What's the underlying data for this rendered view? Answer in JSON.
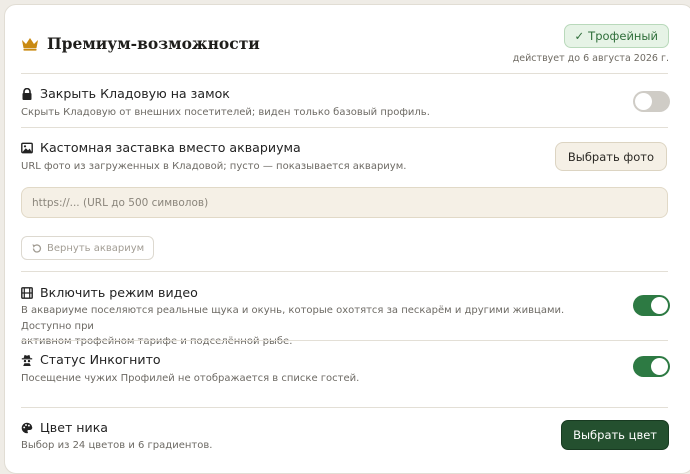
{
  "header": {
    "title": "Премиум-возможности",
    "badge_check": "✓",
    "badge": "Трофейный",
    "valid_until": "действует до 6 августа 2026 г."
  },
  "lock_section": {
    "title": "Закрыть Кладовую на замок",
    "description": "Скрыть Кладовую от внешних посетителей; виден только базовый профиль.",
    "toggle_on": false
  },
  "splash_section": {
    "title": "Кастомная заставка вместо аквариума",
    "description": "URL фото из загруженных в Кладовой; пусто — показывается аквариум.",
    "choose_photo_label": "Выбрать фото",
    "url_value": "",
    "url_placeholder": "https://... (URL до 500 символов)",
    "restore_label": "Вернуть аквариум"
  },
  "video_section": {
    "title": "Включить режим видео",
    "description_line1": "В аквариуме поселяются реальные щука и окунь, которые охотятся за пескарём и другими живцами. Доступно при",
    "description_line2": "активном трофейном тарифе и подселённой рыбе.",
    "toggle_on": true
  },
  "incognito_section": {
    "title": "Статус Инкогнито",
    "description": "Посещение чужих Профилей не отображается в списке гостей.",
    "toggle_on": true
  },
  "nick_color_section": {
    "title": "Цвет ника",
    "description": "Выбор из 24 цветов и 6 градиентов.",
    "choose_color_label": "Выбрать цвет"
  },
  "colors": {
    "accent_green": "#2d7a43",
    "dark_green_button": "#24502f",
    "badge_bg": "#e6f3e6",
    "crown_gold": "#c98a12"
  },
  "icons": {
    "title": "crown-icon",
    "badge": "check-icon",
    "lock": "lock-icon",
    "splash": "image-icon",
    "restore": "undo-icon",
    "video": "film-icon",
    "incognito": "spy-icon",
    "nick_color": "palette-icon"
  }
}
